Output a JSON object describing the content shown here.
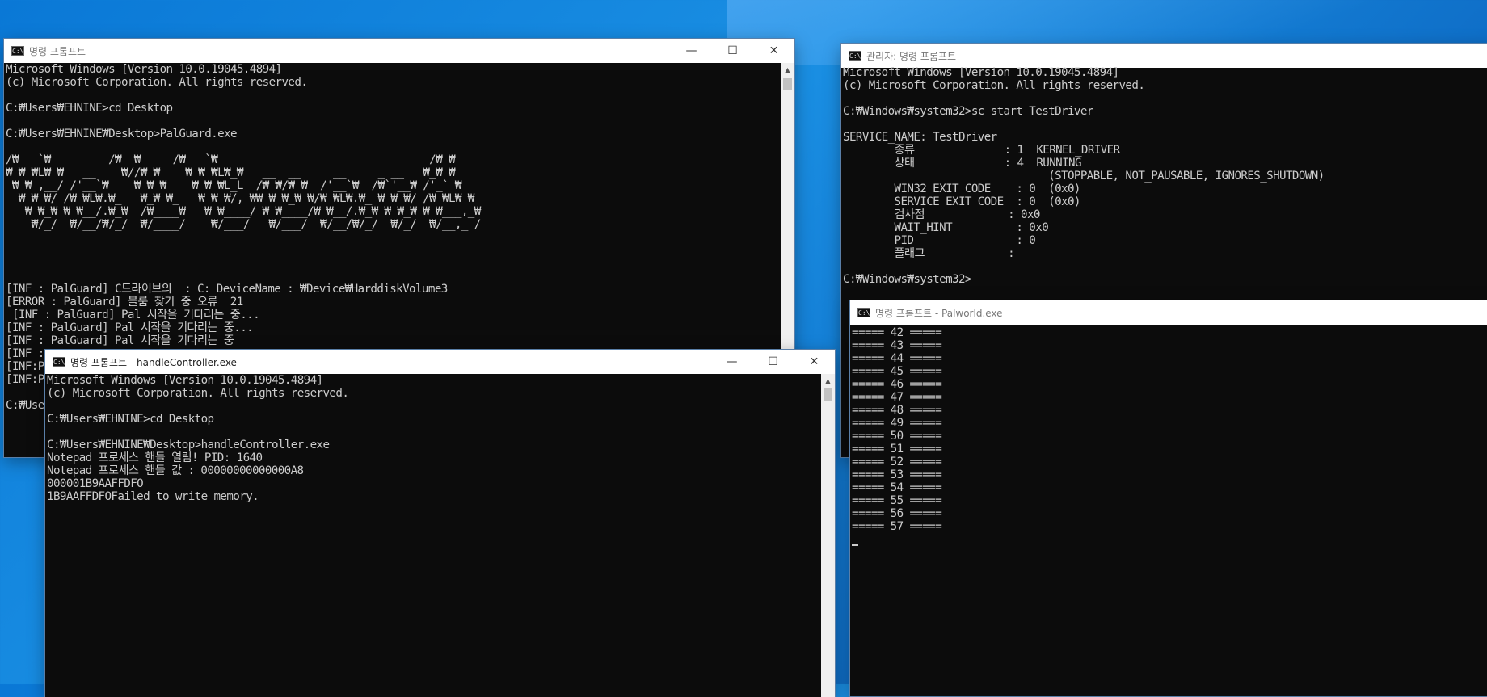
{
  "win1": {
    "title": "명령 프롬프트",
    "icon": "cmd-icon",
    "lines": [
      "Microsoft Windows [Version 10.0.19045.4894]",
      "(c) Microsoft Corporation. All rights reserved.",
      "",
      "C:₩Users₩EHNINE>cd Desktop",
      "",
      "C:₩Users₩EHNINE₩Desktop>PalGuard.exe",
      " ____            ___       ____                                    __",
      "/₩  _`₩         /₩_ ₩     /₩  _`₩                                 /₩ ₩",
      "₩ ₩ ₩L₩ ₩   __    ₩//₩ ₩    ₩ ₩ ₩L₩_₩   __  __     __     _ __   ₩_₩ ₩",
      " ₩ ₩ ,__/ /'__`₩    ₩ ₩ ₩    ₩ ₩ ₩L_L  /₩ ₩/₩ ₩  /'__`₩  /₩`'__₩ /'_` ₩",
      "  ₩ ₩ ₩/ /₩ ₩L₩.₩_   ₩_₩ ₩_   ₩ ₩ ₩/, ₩₩ ₩ ₩_₩ ₩/₩ ₩L₩.₩_ ₩ ₩ ₩/ /₩ ₩L₩ ₩",
      "   ₩ ₩_₩ ₩ ₩__/.₩_₩  /₩____₩   ₩ ₩____/ ₩ ₩____/₩ ₩__/.₩_₩ ₩ ₩_₩ ₩ ₩___,_₩",
      "    ₩/_/  ₩/__/₩/_/  ₩/____/    ₩/___/   ₩/___/  ₩/__/₩/_/  ₩/_/  ₩/__,_ /",
      "",
      "",
      "",
      "",
      "[INF : PalGuard] C드라이브의  : C: DeviceName : ₩Device₩HarddiskVolume3",
      "[ERROR : PalGuard] 블룸 찾기 중 오류  21",
      " [INF : PalGuard] Pal 시작을 기다리는 중...",
      "[INF : PalGuard] Pal 시작을 기다리는 중...",
      "[INF : PalGuard] Pal 시작을 기다리는 중",
      "[INF :",
      "[INF:P",
      "[INF:P",
      "",
      "C:₩Use"
    ]
  },
  "win2": {
    "title": "관리자: 명령 프롬프트",
    "icon": "cmd-icon",
    "lines": [
      "Microsoft Windows [Version 10.0.19045.4894]",
      "(c) Microsoft Corporation. All rights reserved.",
      "",
      "C:₩Windows₩system32>sc start TestDriver",
      "",
      "SERVICE_NAME: TestDriver",
      "        종류              : 1  KERNEL_DRIVER",
      "        상태              : 4  RUNNING",
      "                                (STOPPABLE, NOT_PAUSABLE, IGNORES_SHUTDOWN)",
      "        WIN32_EXIT_CODE    : 0  (0x0)",
      "        SERVICE_EXIT_CODE  : 0  (0x0)",
      "        검사점             : 0x0",
      "        WAIT_HINT          : 0x0",
      "        PID                : 0",
      "        플래그             :",
      "",
      "C:₩Windows₩system32>"
    ]
  },
  "win3": {
    "title": "명령 프롬프트 - handleController.exe",
    "icon": "cmd-icon",
    "lines": [
      "Microsoft Windows [Version 10.0.19045.4894]",
      "(c) Microsoft Corporation. All rights reserved.",
      "",
      "C:₩Users₩EHNINE>cd Desktop",
      "",
      "C:₩Users₩EHNINE₩Desktop>handleController.exe",
      "Notepad 프로세스 핸들 열림! PID: 1640",
      "Notepad 프로세스 핸들 값 : 00000000000000A8",
      "000001B9AAFFDFO",
      "1B9AAFFDFOFailed to write memory."
    ]
  },
  "win4": {
    "title": "명령 프롬프트 - Palworld.exe",
    "icon": "cmd-icon",
    "lines": [
      "===== 42 =====",
      "===== 43 =====",
      "===== 44 =====",
      "===== 45 =====",
      "===== 46 =====",
      "===== 47 =====",
      "===== 48 =====",
      "===== 49 =====",
      "===== 50 =====",
      "===== 51 =====",
      "===== 52 =====",
      "===== 53 =====",
      "===== 54 =====",
      "===== 55 =====",
      "===== 56 =====",
      "===== 57 ====="
    ]
  },
  "controls": {
    "minimize": "—",
    "maximize": "☐",
    "close": "✕"
  },
  "colors": {
    "console_bg": "#0c0c0c",
    "console_text": "#cccccc",
    "desktop": "#0a78d6"
  }
}
